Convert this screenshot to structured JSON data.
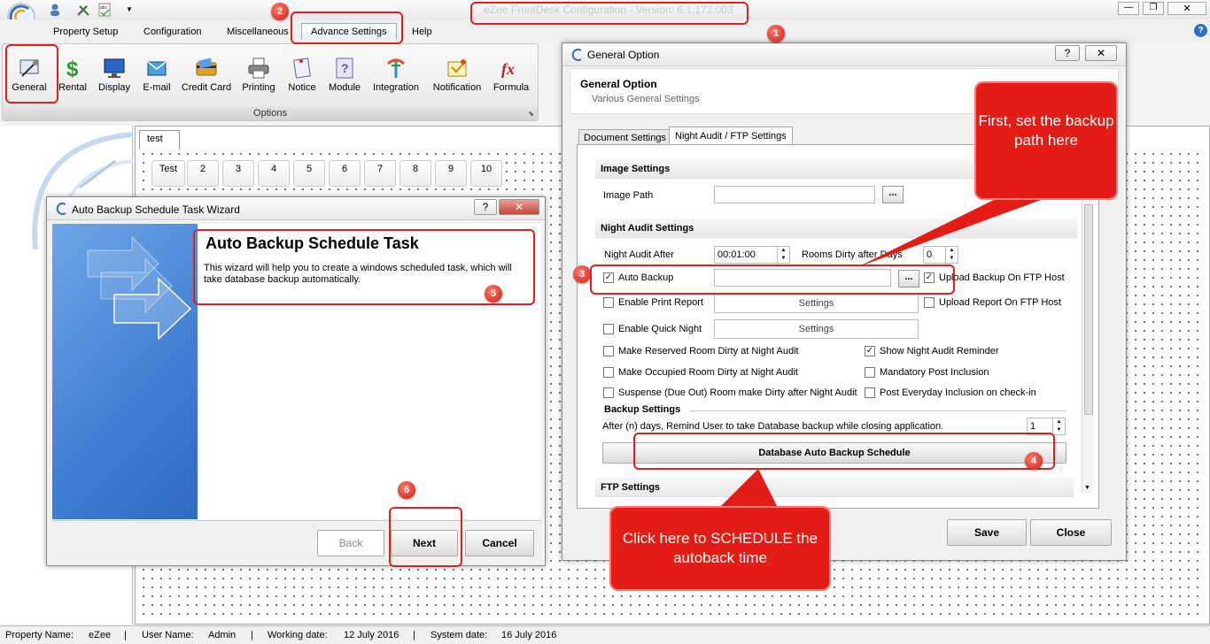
{
  "app": {
    "title": "eZee FrontDesk Configuration - Version: 6.1.172.003"
  },
  "menu": {
    "items": [
      "Property Setup",
      "Configuration",
      "Miscellaneous",
      "Advance Settings",
      "Help"
    ]
  },
  "ribbon": {
    "buttons": [
      "General",
      "Rental",
      "Display",
      "E-mail",
      "Credit Card",
      "Printing",
      "Notice",
      "Module",
      "Integration",
      "Notification",
      "Formula"
    ],
    "group_label": "Options"
  },
  "workarea": {
    "tab": "test",
    "rooms": [
      "Test",
      "2",
      "3",
      "4",
      "5",
      "6",
      "7",
      "8",
      "9",
      "10"
    ]
  },
  "wizard": {
    "title": "Auto Backup Schedule Task Wizard",
    "heading": "Auto Backup Schedule Task",
    "description": "This wizard will help you to create a windows scheduled task, which will take database backup automatically.",
    "back": "Back",
    "next": "Next",
    "cancel": "Cancel"
  },
  "general_option": {
    "title": "General Option",
    "header_title": "General Option",
    "header_sub": "Various General Settings",
    "tabs": [
      "Document Settings",
      "Night Audit / FTP Settings"
    ],
    "image_settings": {
      "heading": "Image Settings",
      "image_path_label": "Image Path",
      "image_path_value": ""
    },
    "night_audit": {
      "heading": "Night Audit Settings",
      "after_label": "Night Audit After",
      "after_value": "00:01:00",
      "rooms_dirty_label": "Rooms Dirty after Days",
      "rooms_dirty_value": "0",
      "auto_backup_label": "Auto Backup",
      "auto_backup_checked": true,
      "auto_backup_path": "",
      "upload_backup_label": "Upload Backup On FTP Host",
      "upload_backup_checked": true,
      "enable_print_label": "Enable Print Report",
      "print_settings": "Settings",
      "upload_report_label": "Upload Report On FTP Host",
      "enable_quick_label": "Enable Quick Night",
      "quick_settings": "Settings",
      "make_reserved_label": "Make Reserved Room Dirty at Night Audit",
      "show_reminder_label": "Show Night Audit Reminder",
      "show_reminder_checked": true,
      "make_occupied_label": "Make Occupied Room Dirty at Night Audit",
      "mandatory_post_label": "Mandatory Post Inclusion",
      "suspense_label": "Suspense (Due Out) Room make Dirty after Night Audit",
      "post_everyday_label": "Post Everyday Inclusion on check-in"
    },
    "backup": {
      "heading": "Backup Settings",
      "remind_label": "After (n) days, Remind User to take Database backup while closing application.",
      "remind_value": "1",
      "schedule_button": "Database Auto Backup Schedule"
    },
    "ftp": {
      "heading": "FTP Settings"
    },
    "save": "Save",
    "close": "Close"
  },
  "callouts": {
    "backup_path": "First, set the backup path here",
    "schedule": "Click here to SCHEDULE the autoback time"
  },
  "badges": [
    "1",
    "2",
    "3",
    "4",
    "5",
    "6"
  ],
  "status": {
    "property_label": "Property Name:",
    "property_value": "eZee",
    "user_label": "User Name:",
    "user_value": "Admin",
    "working_label": "Working date:",
    "working_value": "12 July 2016",
    "system_label": "System date:",
    "system_value": "16 July 2016"
  },
  "colors": {
    "annotation_red": "#e31c16",
    "wizard_blue": "#3f7fd3"
  }
}
